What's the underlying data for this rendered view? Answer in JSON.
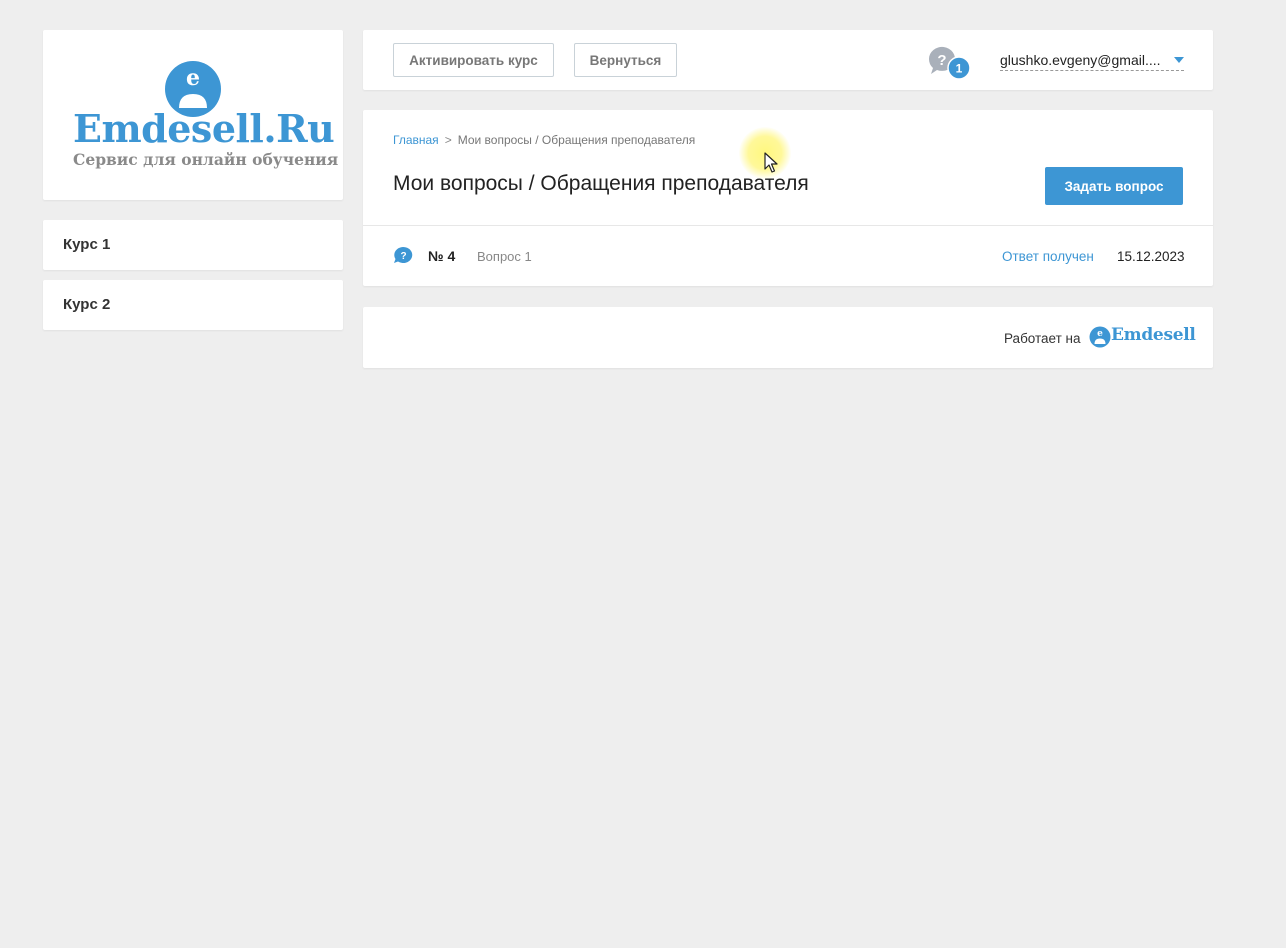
{
  "sidebar": {
    "logo": {
      "title": "Emdesell.Ru",
      "subtitle": "Сервис для онлайн обучения",
      "icon": "user-avatar-icon"
    },
    "courses": [
      {
        "label": "Курс 1"
      },
      {
        "label": "Курс 2"
      }
    ]
  },
  "topbar": {
    "activate_label": "Активировать курс",
    "back_label": "Вернуться",
    "notifications": {
      "icon": "question-bubble-icon",
      "count": "1"
    },
    "user_email": "glushko.evgeny@gmail...."
  },
  "main": {
    "breadcrumb": {
      "home": "Главная",
      "separator": ">",
      "current": "Мои вопросы / Обращения преподавателя"
    },
    "title": "Мои вопросы / Обращения преподавателя",
    "ask_button": "Задать вопрос",
    "questions": [
      {
        "number": "№ 4",
        "title": "Вопрос 1",
        "status": "Ответ получен",
        "date": "15.12.2023",
        "icon": "question-bubble-icon"
      }
    ]
  },
  "footer": {
    "powered_by": "Работает на",
    "brand": "Emdesell"
  },
  "colors": {
    "accent": "#3d96d4",
    "background": "#eeeeee",
    "card": "#ffffff",
    "muted_text": "#888888"
  }
}
